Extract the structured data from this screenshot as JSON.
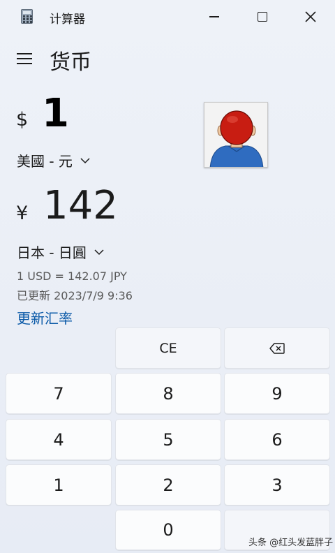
{
  "window": {
    "title": "计算器",
    "controls": {
      "minimize": "minimize",
      "maximize": "maximize",
      "close": "close"
    }
  },
  "header": {
    "mode_title": "货币"
  },
  "converter": {
    "from": {
      "symbol": "$",
      "value": "1",
      "currency": "美國 - 元"
    },
    "to": {
      "symbol": "¥",
      "value": "142",
      "currency": "日本 - 日圓"
    },
    "rate_text": "1 USD = 142.07 JPY",
    "updated_text": "已更新 2023/7/9 9:36",
    "refresh_label": "更新汇率"
  },
  "keypad": {
    "ce_label": "CE",
    "backspace_icon": "backspace-icon",
    "digits": {
      "seven": "7",
      "eight": "8",
      "nine": "9",
      "four": "4",
      "five": "5",
      "six": "6",
      "one": "1",
      "two": "2",
      "three": "3",
      "zero": "0"
    }
  },
  "watermark": "头条 @红头发蓝胖子",
  "colors": {
    "accent_link": "#0b5aa8",
    "background": "#eef2f8",
    "key_face": "#fbfcfd"
  }
}
